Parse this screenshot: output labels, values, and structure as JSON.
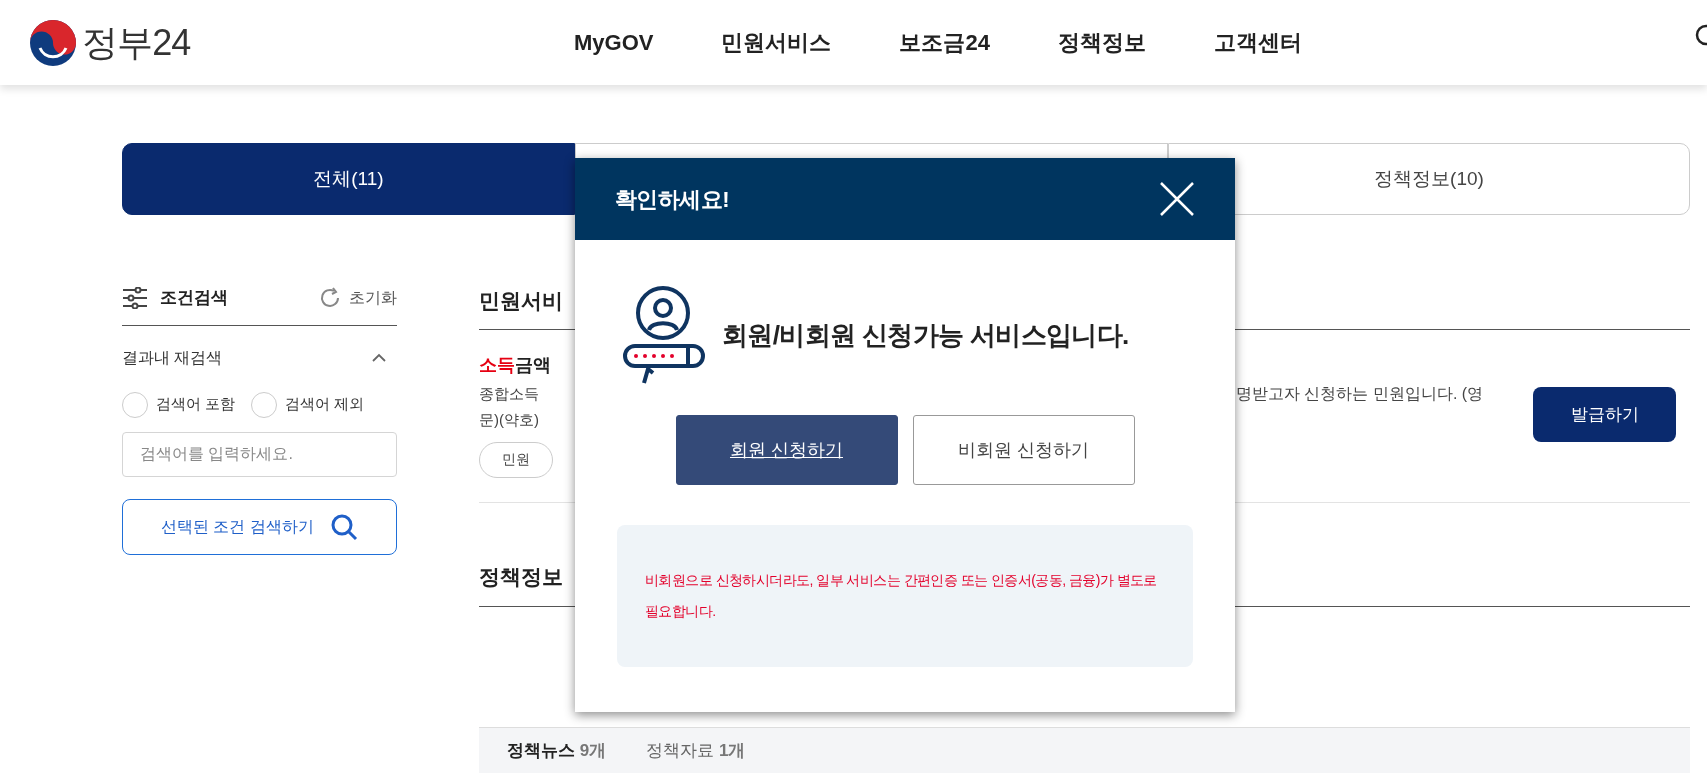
{
  "header": {
    "logo_text": "정부24",
    "nav": [
      "MyGOV",
      "민원서비스",
      "보조금24",
      "정책정보",
      "고객센터"
    ]
  },
  "tabs": [
    {
      "label": "전체(11)",
      "selected": true
    },
    {
      "selected": false
    },
    {
      "label": "정책정보(10)",
      "selected": false
    }
  ],
  "sidebar": {
    "title": "조건검색",
    "reset": "초기화",
    "section": {
      "title": "결과내 재검색",
      "expanded": true
    },
    "radios": [
      {
        "label": "검색어 포함",
        "checked": false
      },
      {
        "label": "검색어 제외",
        "checked": false
      }
    ],
    "search": {
      "placeholder": "검색어를 입력하세요."
    },
    "submit": "선택된 조건 검색하기"
  },
  "main": {
    "section_1": {
      "heading": "민원서비",
      "item": {
        "title": "**소득**금액",
        "desc_left": [
          "종합소득",
          "문)(약호)"
        ],
        "desc_right": "명받고자 신청하는 민원입니다. (영",
        "tag": "민원",
        "action": "발급하기"
      }
    },
    "section_2": {
      "heading": "정책정보",
      "subtabs": [
        {
          "label": "정책뉴스",
          "count": "9개",
          "selected": true
        },
        {
          "label": "정책자료",
          "count": "1개",
          "selected": false
        }
      ]
    }
  },
  "modal": {
    "title": "확인하세요!",
    "heading": "회원/비회원 신청가능 서비스입니다.",
    "buttons": [
      {
        "label": "회원 신청하기",
        "kind": "primary"
      },
      {
        "label": "비회원 신청하기",
        "kind": "secondary"
      }
    ],
    "notice": "비회원으로 신청하시더라도, 일부 서비스는 간편인증 또는 인증서(공동, 금융)가 별도로 필요합니다."
  }
}
